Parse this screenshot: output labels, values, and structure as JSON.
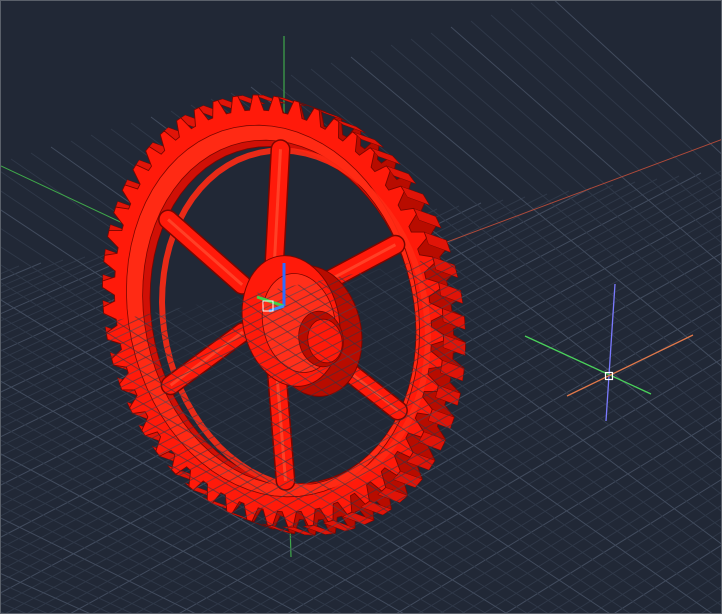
{
  "viewport": {
    "view_style": "3D Wireframe/Realistic",
    "background_color": "#212836",
    "grid": {
      "visible": true,
      "minor_color": "#2f3848",
      "major_color": "#414b5d"
    },
    "world_axes": {
      "x_color": "#b04a3a",
      "y_color": "#3fa84a",
      "z_color": "#3fa84a"
    },
    "model": {
      "name": "spur-gear",
      "color": "#ff1a0a",
      "tooth_count": 52,
      "spoke_count": 6
    },
    "ucs_icon": {
      "x_color": "#3a8dff",
      "y_color": "#3fd24a",
      "z_color": "#2f6bff"
    },
    "cursor": {
      "type": "crosshair",
      "colors": {
        "x_axis": "#e0784a",
        "y_axis": "#4ad25a",
        "z_axis": "#7a7aff"
      }
    }
  }
}
